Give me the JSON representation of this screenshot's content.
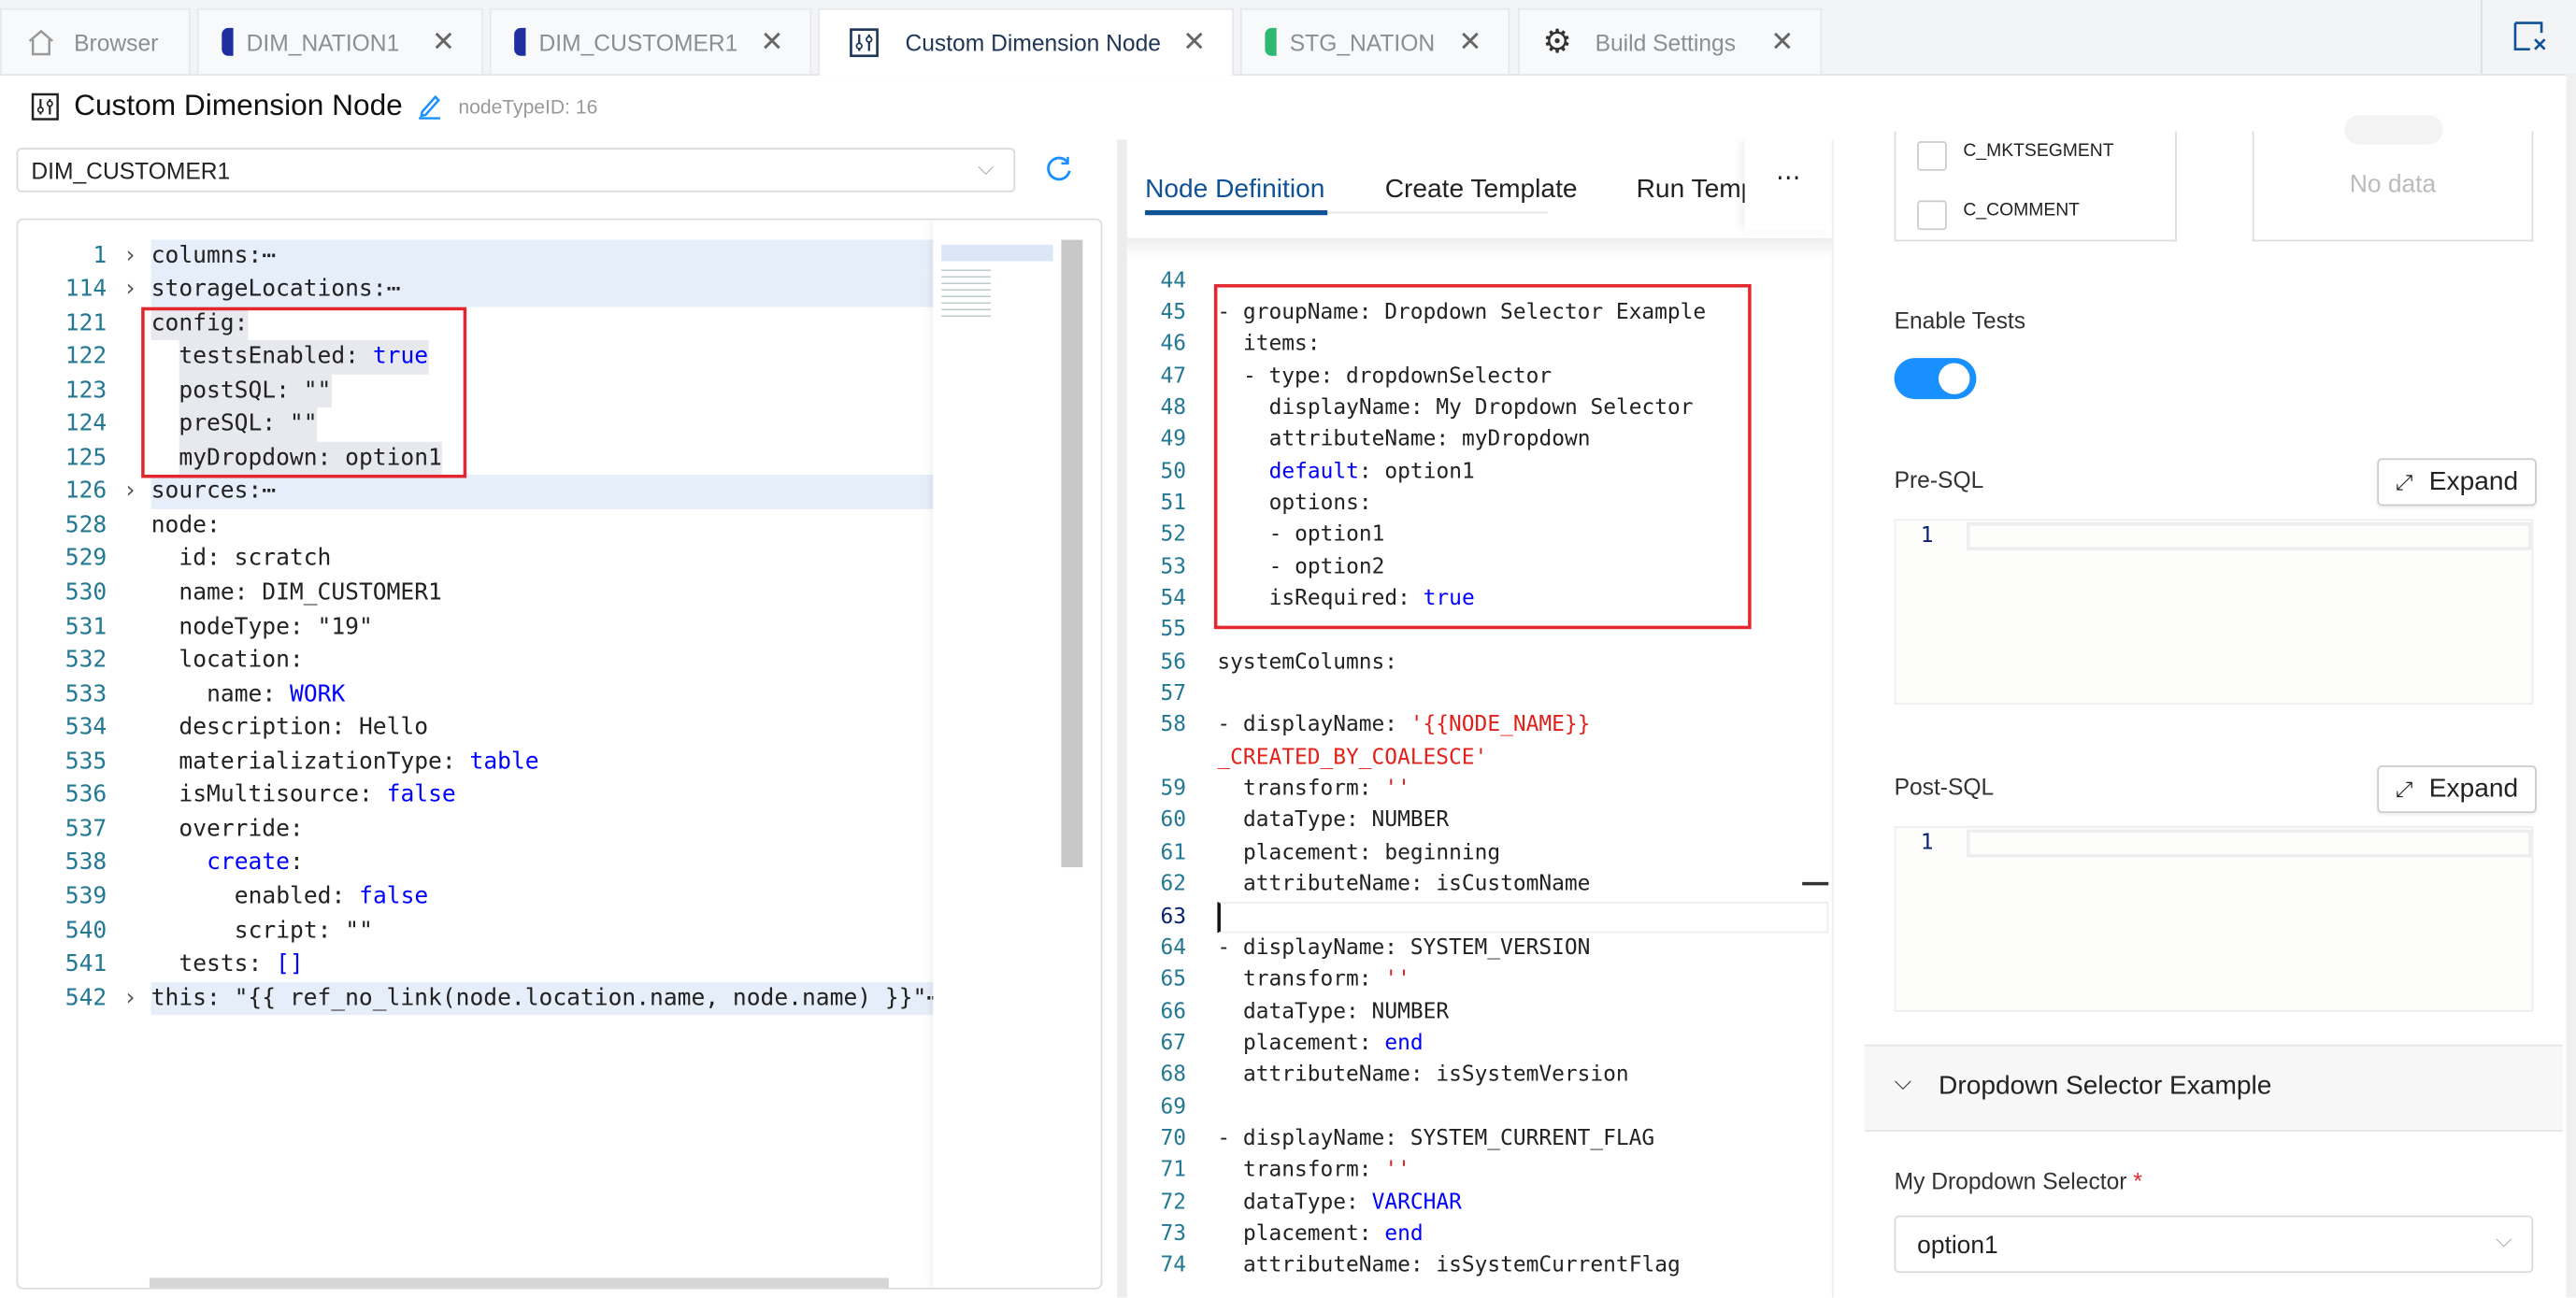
{
  "tabs": [
    {
      "label": "Browser",
      "icon": "home-icon"
    },
    {
      "label": "DIM_NATION1",
      "color": "#1f2fa0"
    },
    {
      "label": "DIM_CUSTOMER1",
      "color": "#1f2fa0"
    },
    {
      "label": "Custom Dimension Node",
      "icon": "node-type-icon",
      "active": true
    },
    {
      "label": "STG_NATION",
      "color": "#2fb872"
    },
    {
      "label": "Build Settings",
      "icon": "gear-icon"
    }
  ],
  "header": {
    "title": "Custom Dimension Node",
    "node_type_id": "nodeTypeID: 16"
  },
  "node_select": {
    "value": "DIM_CUSTOMER1"
  },
  "left_code": [
    {
      "n": "1",
      "fold": true,
      "hl": true,
      "segs": [
        [
          "",
          "columns:"
        ],
        [
          "",
          "⋯"
        ]
      ]
    },
    {
      "n": "114",
      "fold": true,
      "hl": true,
      "segs": [
        [
          "",
          "storageLocations:"
        ],
        [
          "",
          "⋯"
        ]
      ]
    },
    {
      "n": "121",
      "sel": true,
      "segs": [
        [
          "",
          "config:"
        ]
      ]
    },
    {
      "n": "122",
      "i": 1,
      "sel": true,
      "segs": [
        [
          "",
          "testsEnabled: "
        ],
        [
          "b",
          "true"
        ]
      ]
    },
    {
      "n": "123",
      "i": 1,
      "sel": true,
      "segs": [
        [
          "",
          "postSQL: \"\""
        ]
      ]
    },
    {
      "n": "124",
      "i": 1,
      "sel": true,
      "segs": [
        [
          "",
          "preSQL: \"\""
        ]
      ]
    },
    {
      "n": "125",
      "i": 1,
      "sel": true,
      "segs": [
        [
          "",
          "myDropdown: option1"
        ]
      ]
    },
    {
      "n": "126",
      "fold": true,
      "hl": true,
      "segs": [
        [
          "",
          "sources:"
        ],
        [
          "",
          "⋯"
        ]
      ]
    },
    {
      "n": "528",
      "segs": [
        [
          "",
          "node:"
        ]
      ]
    },
    {
      "n": "529",
      "i": 1,
      "segs": [
        [
          "",
          "id: scratch"
        ]
      ]
    },
    {
      "n": "530",
      "i": 1,
      "segs": [
        [
          "",
          "name: DIM_CUSTOMER1"
        ]
      ]
    },
    {
      "n": "531",
      "i": 1,
      "segs": [
        [
          "",
          "nodeType: \"19\""
        ]
      ]
    },
    {
      "n": "532",
      "i": 1,
      "segs": [
        [
          "",
          "location:"
        ]
      ]
    },
    {
      "n": "533",
      "i": 2,
      "segs": [
        [
          "",
          "name: "
        ],
        [
          "b",
          "WORK"
        ]
      ]
    },
    {
      "n": "534",
      "i": 1,
      "segs": [
        [
          "",
          "description: Hello"
        ]
      ]
    },
    {
      "n": "535",
      "i": 1,
      "segs": [
        [
          "",
          "materializationType: "
        ],
        [
          "b",
          "table"
        ]
      ]
    },
    {
      "n": "536",
      "i": 1,
      "segs": [
        [
          "",
          "isMultisource: "
        ],
        [
          "b",
          "false"
        ]
      ]
    },
    {
      "n": "537",
      "i": 1,
      "segs": [
        [
          "",
          "override:"
        ]
      ]
    },
    {
      "n": "538",
      "i": 2,
      "segs": [
        [
          "b",
          "create"
        ],
        [
          "",
          ":"
        ]
      ]
    },
    {
      "n": "539",
      "i": 3,
      "segs": [
        [
          "",
          "enabled: "
        ],
        [
          "b",
          "false"
        ]
      ]
    },
    {
      "n": "540",
      "i": 3,
      "segs": [
        [
          "",
          "script: \"\""
        ]
      ]
    },
    {
      "n": "541",
      "i": 1,
      "segs": [
        [
          "",
          "tests: "
        ],
        [
          "b",
          "[]"
        ]
      ]
    },
    {
      "n": "542",
      "fold": true,
      "hl": true,
      "segs": [
        [
          "",
          "this: \"{{ ref_no_link(node.location.name, node.name) }}\""
        ],
        [
          "",
          "⋯"
        ]
      ]
    }
  ],
  "mid_tabs": [
    {
      "label": "Node Definition",
      "active": true
    },
    {
      "label": "Create Template"
    },
    {
      "label": "Run Temp"
    }
  ],
  "mid_code": [
    {
      "n": "44",
      "segs": []
    },
    {
      "n": "45",
      "segs": [
        [
          "",
          "- groupName: Dropdown Selector Example"
        ]
      ]
    },
    {
      "n": "46",
      "i": 1,
      "segs": [
        [
          "",
          "items:"
        ]
      ]
    },
    {
      "n": "47",
      "i": 1,
      "segs": [
        [
          "",
          "- type: dropdownSelector"
        ]
      ]
    },
    {
      "n": "48",
      "i": 2,
      "segs": [
        [
          "",
          "displayName: My Dropdown Selector"
        ]
      ]
    },
    {
      "n": "49",
      "i": 2,
      "segs": [
        [
          "",
          "attributeName: myDropdown"
        ]
      ]
    },
    {
      "n": "50",
      "i": 2,
      "segs": [
        [
          "b",
          "default"
        ],
        [
          "",
          ": option1"
        ]
      ]
    },
    {
      "n": "51",
      "i": 2,
      "segs": [
        [
          "",
          "options:"
        ]
      ]
    },
    {
      "n": "52",
      "i": 2,
      "segs": [
        [
          "",
          "- option1"
        ]
      ]
    },
    {
      "n": "53",
      "i": 2,
      "segs": [
        [
          "",
          "- option2"
        ]
      ]
    },
    {
      "n": "54",
      "i": 2,
      "segs": [
        [
          "",
          "isRequired: "
        ],
        [
          "b",
          "true"
        ]
      ]
    },
    {
      "n": "55",
      "segs": []
    },
    {
      "n": "56",
      "segs": [
        [
          "",
          "systemColumns:"
        ]
      ]
    },
    {
      "n": "57",
      "segs": []
    },
    {
      "n": "58",
      "segs": [
        [
          "",
          "- displayName: "
        ],
        [
          "r",
          "'{{NODE_NAME}}"
        ]
      ]
    },
    {
      "n": "",
      "segs": [
        [
          "r",
          "_CREATED_BY_COALESCE'"
        ]
      ]
    },
    {
      "n": "59",
      "i": 1,
      "segs": [
        [
          "",
          "transform: "
        ],
        [
          "r",
          "''"
        ]
      ]
    },
    {
      "n": "60",
      "i": 1,
      "segs": [
        [
          "",
          "dataType: NUMBER"
        ]
      ]
    },
    {
      "n": "61",
      "i": 1,
      "segs": [
        [
          "",
          "placement: beginning"
        ]
      ]
    },
    {
      "n": "62",
      "i": 1,
      "segs": [
        [
          "",
          "attributeName: isCustomName"
        ]
      ]
    },
    {
      "n": "63",
      "cur": true,
      "segs": []
    },
    {
      "n": "64",
      "segs": [
        [
          "",
          "- displayName: SYSTEM_VERSION"
        ]
      ]
    },
    {
      "n": "65",
      "i": 1,
      "segs": [
        [
          "",
          "transform: "
        ],
        [
          "r",
          "''"
        ]
      ]
    },
    {
      "n": "66",
      "i": 1,
      "segs": [
        [
          "",
          "dataType: NUMBER"
        ]
      ]
    },
    {
      "n": "67",
      "i": 1,
      "segs": [
        [
          "",
          "placement: "
        ],
        [
          "b",
          "end"
        ]
      ]
    },
    {
      "n": "68",
      "i": 1,
      "segs": [
        [
          "",
          "attributeName: isSystemVersion"
        ]
      ]
    },
    {
      "n": "69",
      "segs": []
    },
    {
      "n": "70",
      "segs": [
        [
          "",
          "- displayName: SYSTEM_CURRENT_FLAG"
        ]
      ]
    },
    {
      "n": "71",
      "i": 1,
      "segs": [
        [
          "",
          "transform: "
        ],
        [
          "r",
          "''"
        ]
      ]
    },
    {
      "n": "72",
      "i": 1,
      "segs": [
        [
          "",
          "dataType: "
        ],
        [
          "b",
          "VARCHAR"
        ]
      ]
    },
    {
      "n": "73",
      "i": 1,
      "segs": [
        [
          "",
          "placement: "
        ],
        [
          "b",
          "end"
        ]
      ]
    },
    {
      "n": "74",
      "i": 1,
      "segs": [
        [
          "",
          "attributeName: isSystemCurrentFlag"
        ]
      ]
    }
  ],
  "right": {
    "columns": [
      "C_MKTSEGMENT",
      "C_COMMENT"
    ],
    "no_data": "No data",
    "enable_tests_label": "Enable Tests",
    "enable_tests_on": true,
    "pre_sql_label": "Pre-SQL",
    "post_sql_label": "Post-SQL",
    "expand_label": "Expand",
    "line_one": "1",
    "section_title": "Dropdown Selector Example",
    "dropdown_label": "My Dropdown Selector",
    "required_mark": "*",
    "dropdown_value": "option1"
  },
  "colors": {
    "accent": "#1890ff",
    "tab_active": "#0f5296",
    "highlight_box": "#e3272f"
  }
}
